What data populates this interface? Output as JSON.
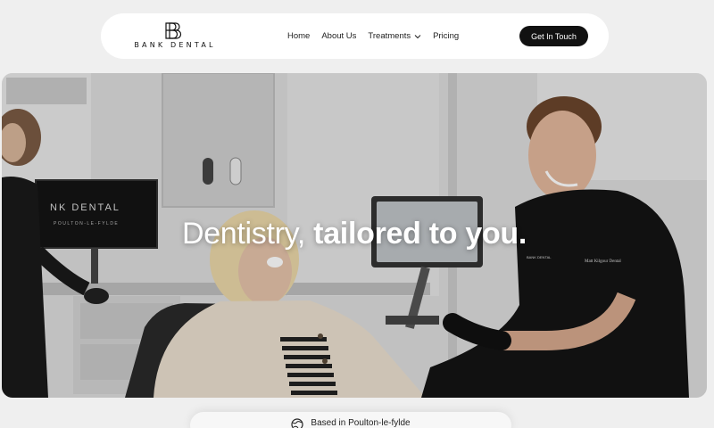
{
  "nav": {
    "logo_text": "BANK DENTAL",
    "items": [
      {
        "label": "Home"
      },
      {
        "label": "About Us"
      },
      {
        "label": "Treatments",
        "has_dropdown": true
      },
      {
        "label": "Pricing"
      }
    ],
    "cta_label": "Get In Touch"
  },
  "hero": {
    "headline_light": "Dentistry,",
    "headline_bold": "tailored to you.",
    "monitor_text": "NK DENTAL",
    "monitor_subtext": "POULTON-LE-FYLDE",
    "scrubs_logo": "BANK DENTAL",
    "scrubs_name": "Matt Kilgour Dental"
  },
  "badge": {
    "icon": "globe-icon",
    "text": "Based in Poulton-le-fylde"
  },
  "colors": {
    "page_bg": "#efefef",
    "nav_bg": "#ffffff",
    "cta_bg": "#111111",
    "headline": "#ffffff"
  }
}
